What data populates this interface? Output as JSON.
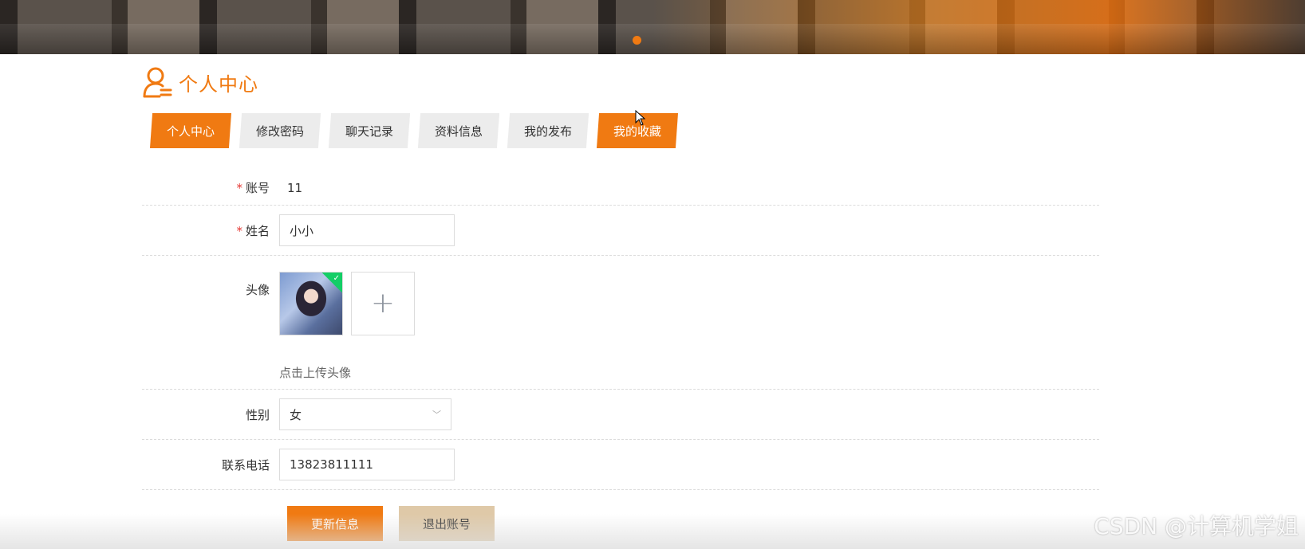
{
  "page": {
    "title": "个人中心",
    "accent_color": "#f07a12",
    "title_icon": "user-profile-icon"
  },
  "tabs": [
    {
      "label": "个人中心",
      "active": true
    },
    {
      "label": "修改密码",
      "active": false
    },
    {
      "label": "聊天记录",
      "active": false
    },
    {
      "label": "资料信息",
      "active": false
    },
    {
      "label": "我的发布",
      "active": false
    },
    {
      "label": "我的收藏",
      "active": true
    }
  ],
  "form": {
    "account": {
      "label": "账号",
      "required": "*",
      "value": "11"
    },
    "name": {
      "label": "姓名",
      "required": "*",
      "value": "小小"
    },
    "avatar": {
      "label": "头像",
      "hint": "点击上传头像",
      "upload_icon": "plus-icon"
    },
    "gender": {
      "label": "性别",
      "value": "女"
    },
    "phone": {
      "label": "联系电话",
      "value": "13823811111"
    }
  },
  "buttons": {
    "update": "更新信息",
    "logout": "退出账号"
  },
  "watermark": "CSDN @计算机学姐"
}
